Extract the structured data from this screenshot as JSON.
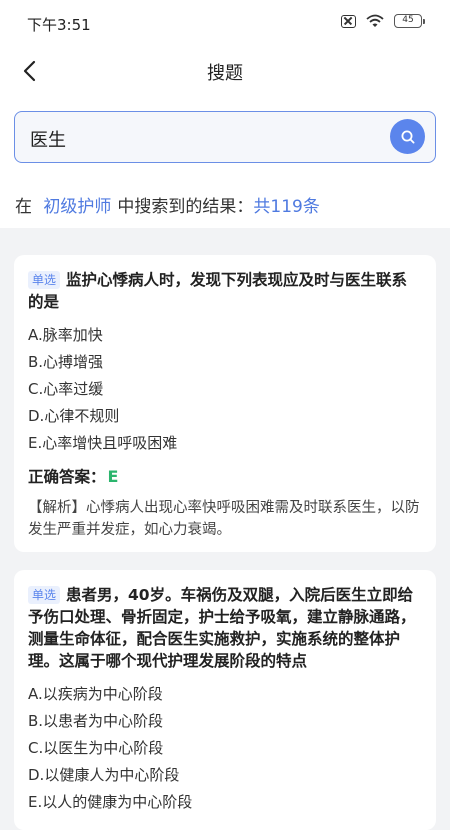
{
  "status_bar": {
    "time": "下午3:51",
    "battery": "45"
  },
  "nav": {
    "title": "搜题"
  },
  "search": {
    "value": "医生"
  },
  "result": {
    "prefix": "在",
    "category": "初级护师",
    "middle": "中搜索到的结果：",
    "count": "共119条"
  },
  "questions": [
    {
      "tag": "单选",
      "stem": "监护心悸病人时，发现下列表现应及时与医生联系的是",
      "options": [
        "A.脉率加快",
        "B.心搏增强",
        "C.心率过缓",
        "D.心律不规则",
        "E.心率增快且呼吸困难"
      ],
      "answer_label": "正确答案：",
      "answer": "E",
      "analysis": "【解析】心悸病人出现心率快呼吸困难需及时联系医生，以防发生严重并发症，如心力衰竭。"
    },
    {
      "tag": "单选",
      "stem": "患者男，40岁。车祸伤及双腿，入院后医生立即给予伤口处理、骨折固定，护士给予吸氧，建立静脉通路，测量生命体征，配合医生实施救护，实施系统的整体护理。这属于哪个现代护理发展阶段的特点",
      "options": [
        "A.以疾病为中心阶段",
        "B.以患者为中心阶段",
        "C.以医生为中心阶段",
        "D.以健康人为中心阶段",
        "E.以人的健康为中心阶段"
      ]
    }
  ],
  "colors": {
    "accent": "#5b85ec",
    "answer": "#2bb56d",
    "highlight": "#4f7ae0"
  }
}
